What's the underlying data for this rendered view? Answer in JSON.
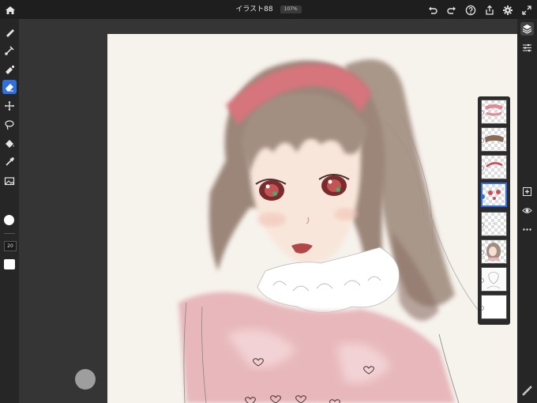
{
  "app": {
    "title": "イラスト88",
    "zoom": "107%"
  },
  "toolbar_top": {
    "icons": [
      "home-icon",
      "undo-icon",
      "redo-icon",
      "help-icon",
      "share-icon",
      "settings-icon",
      "fullscreen-icon"
    ]
  },
  "tools": {
    "items": [
      {
        "name": "pixel-brush",
        "icon": "pixel-brush-icon"
      },
      {
        "name": "live-brush",
        "icon": "live-brush-icon"
      },
      {
        "name": "vector-brush",
        "icon": "vector-brush-icon"
      },
      {
        "name": "eraser",
        "icon": "eraser-icon",
        "active": true
      },
      {
        "name": "transform",
        "icon": "transform-icon"
      },
      {
        "name": "selection",
        "icon": "lasso-icon"
      },
      {
        "name": "fill",
        "icon": "fill-bucket-icon"
      },
      {
        "name": "eyedropper",
        "icon": "eyedropper-icon"
      },
      {
        "name": "image",
        "icon": "image-icon"
      }
    ],
    "brush_size": "20",
    "current_color": "#ffffff",
    "accent_color": "#2f6fe0"
  },
  "right_panel": {
    "icons": [
      "layers-icon",
      "adjust-icon",
      "add-layer-icon",
      "visibility-icon",
      "more-icon",
      "ruler-icon"
    ]
  },
  "layers": {
    "count": 8,
    "selected_index": 3
  }
}
